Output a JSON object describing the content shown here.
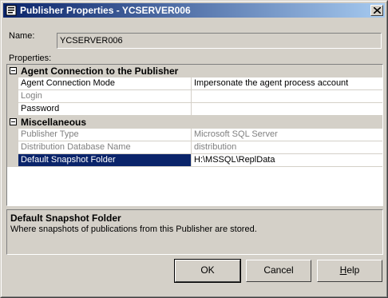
{
  "window": {
    "title": "Publisher Properties - YCSERVER006",
    "close_label": "X"
  },
  "name_field": {
    "label": "Name:",
    "value": "YCSERVER006"
  },
  "properties_label": "Properties:",
  "categories": [
    {
      "title": "Agent Connection to the Publisher",
      "rows": [
        {
          "name": "Agent Connection Mode",
          "value": "Impersonate the agent process account",
          "disabled": false
        },
        {
          "name": "Login",
          "value": "",
          "disabled": true
        },
        {
          "name": "Password",
          "value": "",
          "disabled": false
        }
      ]
    },
    {
      "title": "Miscellaneous",
      "rows": [
        {
          "name": "Publisher Type",
          "value": "Microsoft SQL Server",
          "disabled": true
        },
        {
          "name": "Distribution Database Name",
          "value": "distribution",
          "disabled": true
        },
        {
          "name": "Default Snapshot Folder",
          "value": "H:\\MSSQL\\ReplData",
          "disabled": false,
          "selected": true
        }
      ]
    }
  ],
  "description": {
    "title": "Default Snapshot Folder",
    "text": "Where snapshots of publications from this Publisher are stored."
  },
  "buttons": {
    "ok": "OK",
    "cancel": "Cancel",
    "help": "Help"
  }
}
